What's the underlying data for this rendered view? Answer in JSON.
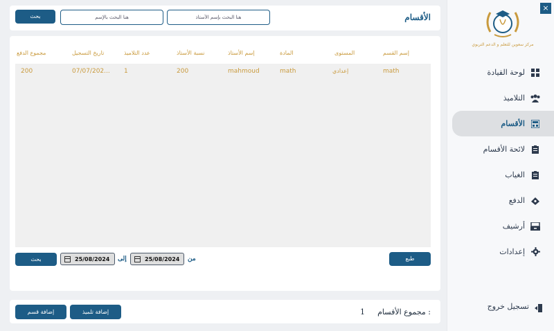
{
  "sidebar": {
    "logo_caption": "مركز سعوين للتعلم و الدعم التربوي",
    "items": [
      {
        "label": "لوحة القيادة",
        "icon": "dashboard-icon"
      },
      {
        "label": "التلاميذ",
        "icon": "users-icon"
      },
      {
        "label": "الأقسام",
        "icon": "classes-icon",
        "active": true
      },
      {
        "label": "لائحة الأقسام",
        "icon": "list-icon"
      },
      {
        "label": "الغياب",
        "icon": "absence-icon"
      },
      {
        "label": "الدفع",
        "icon": "payment-icon"
      },
      {
        "label": "أرشيف",
        "icon": "archive-icon"
      },
      {
        "label": "إعدادات",
        "icon": "settings-icon"
      }
    ],
    "logout_label": "تسجيل خروج",
    "close_label": "×"
  },
  "header": {
    "title": "الأقسام",
    "search_teacher_placeholder": "هنا البحث بإسم الأستاذ",
    "search_name_placeholder": "هنا البحث بالإسم",
    "search_button": "بحث"
  },
  "table": {
    "columns": [
      "إسم القسم",
      "المستوى",
      "المادة",
      "إسم الأستاذ",
      "نسبة الأستاذ",
      "عدد التلاميذ",
      "تاريخ التسجيل",
      "مجموع الدفع"
    ],
    "rows": [
      [
        "math",
        "إعدادي",
        "math",
        "mahmoud",
        "200",
        "1",
        "07/07/202...",
        "200"
      ]
    ]
  },
  "filters": {
    "print_button": "طبع",
    "from_label": "من",
    "to_label": "إلى",
    "from_date": "25/08/2024",
    "to_date": "25/08/2024",
    "search_button": "بحث"
  },
  "footer": {
    "total_label": "مجموع الأقسام :",
    "total_value": "1",
    "add_student_button": "إضافة تلميذ",
    "add_class_button": "إضافة قسم"
  },
  "colors": {
    "primary": "#1d5c86",
    "accent_gold": "#c99a3d"
  }
}
